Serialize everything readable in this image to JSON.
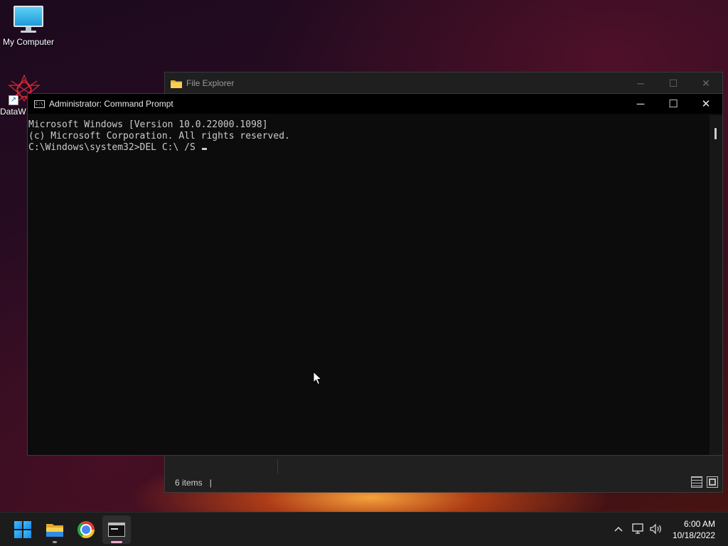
{
  "desktop": {
    "icons": [
      {
        "label": "My Computer"
      },
      {
        "label": "DataW"
      }
    ]
  },
  "file_explorer": {
    "title": "File Explorer",
    "status": "6 items"
  },
  "cmd": {
    "title": "Administrator: Command Prompt",
    "lines": [
      "Microsoft Windows [Version 10.0.22000.1098]",
      "(c) Microsoft Corporation. All rights reserved.",
      "C:\\Windows\\system32>DEL C:\\ /S "
    ]
  },
  "taskbar": {
    "apps": [
      {
        "name": "Start",
        "icon": "windows-logo-icon"
      },
      {
        "name": "File Explorer",
        "icon": "folder-icon"
      },
      {
        "name": "Google Chrome",
        "icon": "chrome-icon"
      },
      {
        "name": "Command Prompt",
        "icon": "terminal-icon"
      }
    ],
    "clock": {
      "time": "6:00 AM",
      "date": "10/18/2022"
    }
  },
  "colors": {
    "console_bg": "#0c0c0c",
    "console_text": "#cccccc",
    "taskbar_bg": "#1c1c1c",
    "active_indicator": "#f0a8d0"
  }
}
